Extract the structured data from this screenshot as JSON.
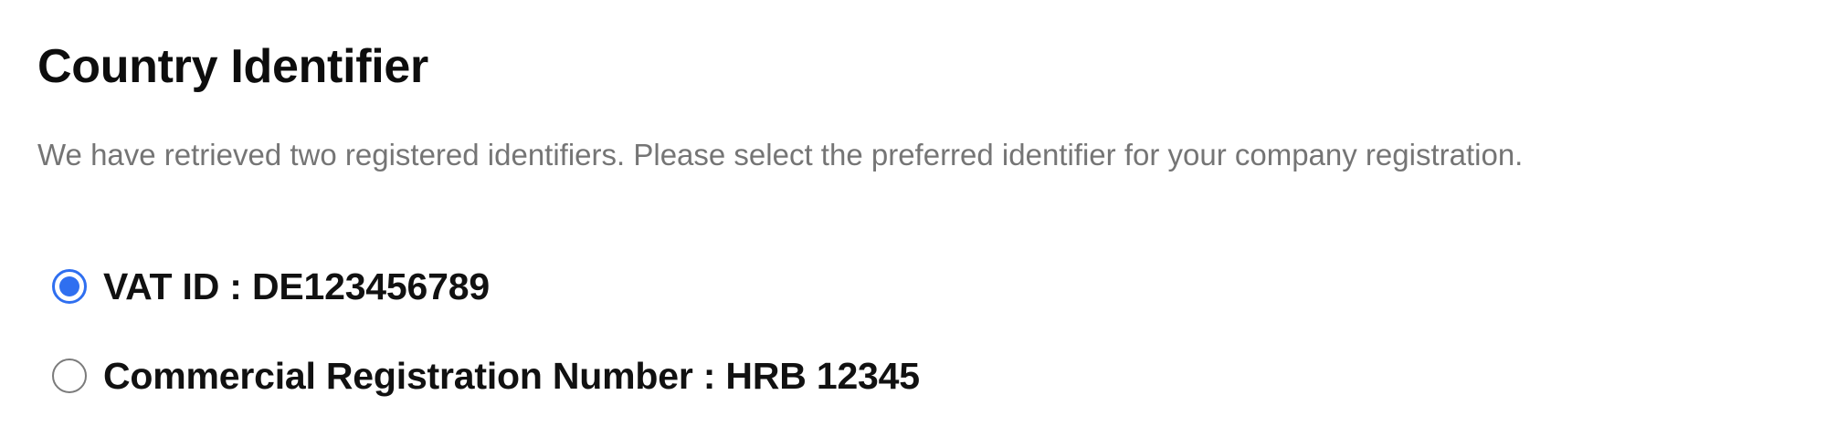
{
  "header": {
    "title": "Country Identifier",
    "description": "We have retrieved two registered identifiers. Please select the preferred identifier for your company registration."
  },
  "options": [
    {
      "label": "VAT ID : DE123456789",
      "selected": true
    },
    {
      "label": "Commercial Registration Number : HRB 12345",
      "selected": false
    }
  ],
  "colors": {
    "accent": "#2f6ff0",
    "radio_border": "#7b7b7b",
    "description_text": "#757575",
    "title_text": "#0d0d0d"
  }
}
